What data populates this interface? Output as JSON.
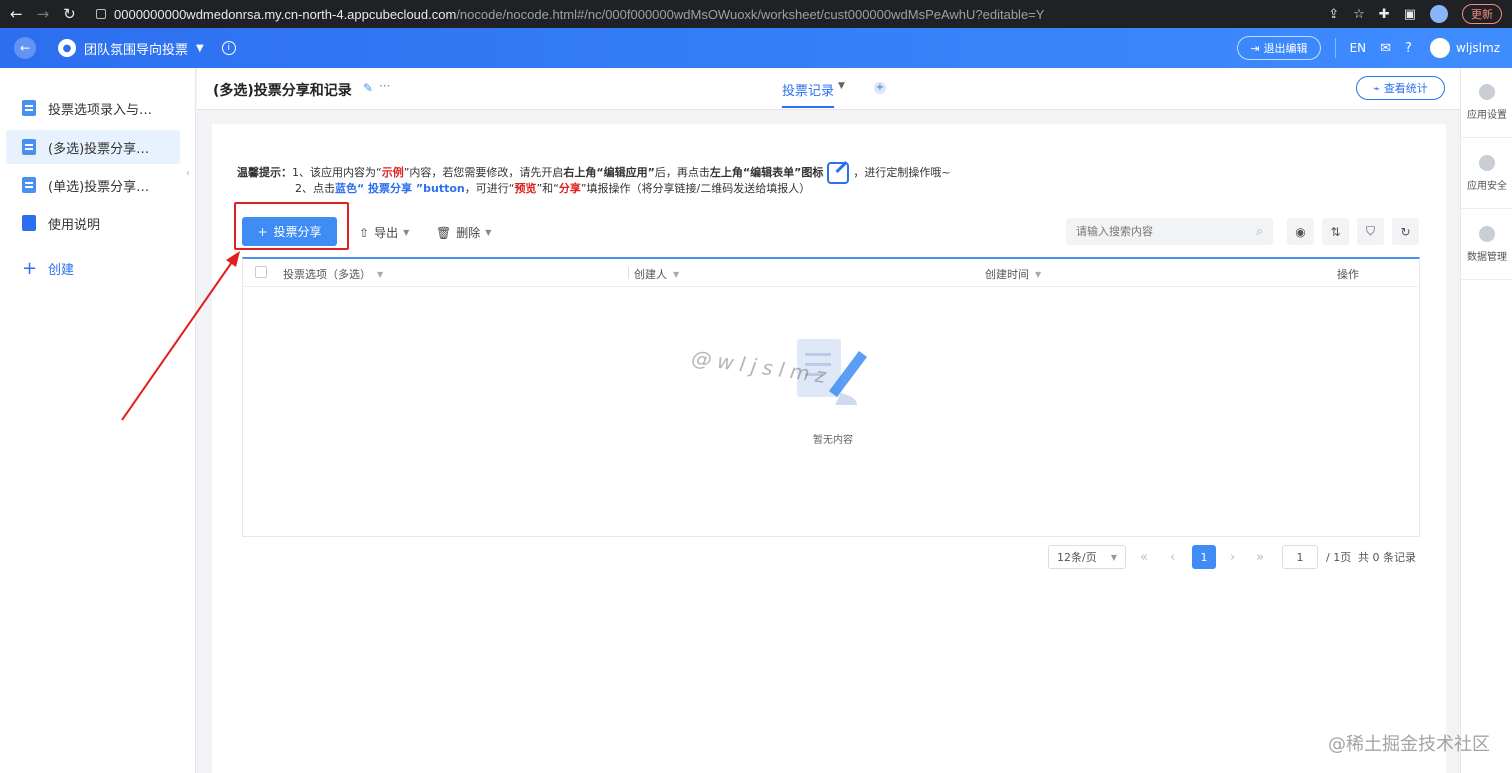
{
  "browser": {
    "url_host": "0000000000wdmedonrsa.my.cn-north-4.appcubecloud.com",
    "url_path": "/nocode/nocode.html#/nc/000f000000wdMsOWuoxk/worksheet/cust000000wdMsPeAwhU?editable=Y",
    "update_label": "更新"
  },
  "header": {
    "app_name": "团队氛围导向投票",
    "exit_edit_label": "退出编辑",
    "lang_label": "EN",
    "username": "wljslmz"
  },
  "sidebar": {
    "items": [
      {
        "label": "投票选项录入与…"
      },
      {
        "label": "(多选)投票分享…"
      },
      {
        "label": "(单选)投票分享…"
      },
      {
        "label": "使用说明"
      }
    ],
    "create_label": "创建"
  },
  "topbar": {
    "title": "(多选)投票分享和记录",
    "more": "···",
    "view_tab": "投票记录",
    "stats_label": "查看统计"
  },
  "tips": {
    "line1_a": "温馨提示：",
    "line1_b": "1、该应用内容为“",
    "line1_c": "示例",
    "line1_d": "”内容，若您需要修改，请先开启",
    "line1_e": "右上角“编辑应用”",
    "line1_f": "后，再点击",
    "line1_g": "左上角“编辑表单”图标",
    "line1_h": "，进行定制操作哦~",
    "line2_a": "2、点击",
    "line2_b": "蓝色“ 投票分享 ”button",
    "line2_c": "，可进行“",
    "line2_d": "预览",
    "line2_e": "”和“",
    "line2_f": "分享",
    "line2_g": "”填报操作（将分享链接/二维码发送给填报人）"
  },
  "toolbar": {
    "primary_label": "投票分享",
    "export_label": "导出",
    "delete_label": "删除",
    "search_placeholder": "请输入搜索内容"
  },
  "table": {
    "columns": [
      "投票选项（多选）",
      "创建人",
      "创建时间",
      "操作"
    ],
    "empty_text": "暂无内容",
    "watermark": "@wljslmz"
  },
  "pagination": {
    "page_size": "12条/页",
    "current_page": "1",
    "jump_value": "1",
    "total_pages": "/ 1页",
    "total_records": "共 0 条记录"
  },
  "rail": {
    "items": [
      {
        "label": "应用设置"
      },
      {
        "label": "应用安全"
      },
      {
        "label": "数据管理"
      }
    ]
  },
  "brand_watermark": "@稀土掘金技术社区",
  "colors": {
    "primary": "#3f8cf5",
    "header_start": "#2c6ff0",
    "header_end": "#3f8cff",
    "annotation_red": "#e02020"
  }
}
